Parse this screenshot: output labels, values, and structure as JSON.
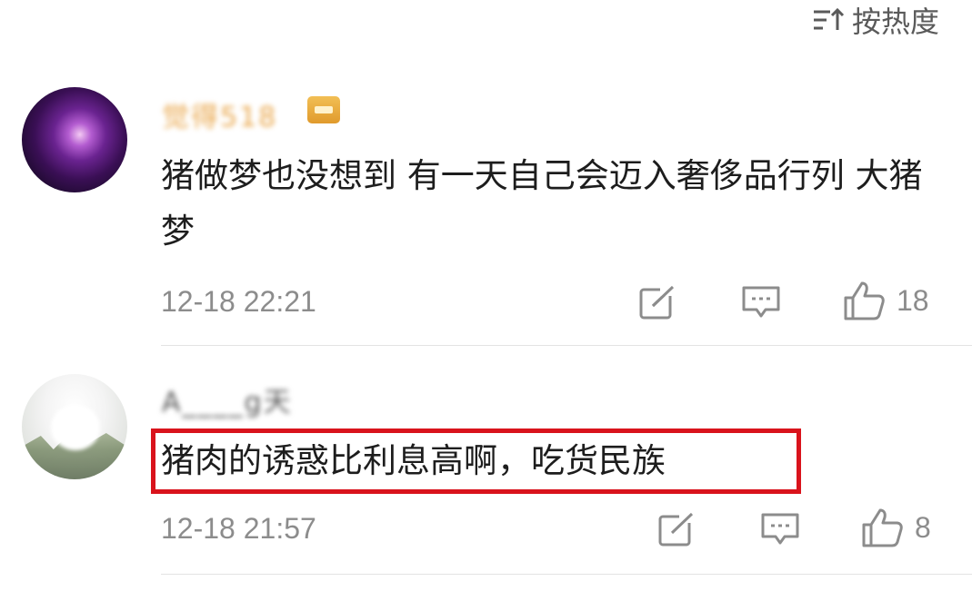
{
  "sort": {
    "label": "按热度",
    "icon": "sort-lines-icon"
  },
  "comments": [
    {
      "username": "觉得518",
      "text": "猪做梦也没想到 有一天自己会迈入奢侈品行列  大猪梦",
      "time": "12-18 22:21",
      "likes": "18",
      "highlighted": false
    },
    {
      "username": "A____g天",
      "text": "猪肉的诱惑比利息高啊，吃货民族",
      "time": "12-18 21:57",
      "likes": "8",
      "highlighted": true
    }
  ],
  "colors": {
    "highlight_border": "#d9131c",
    "meta_text": "#8c8c8c",
    "username_gold": "#e9a64a"
  }
}
